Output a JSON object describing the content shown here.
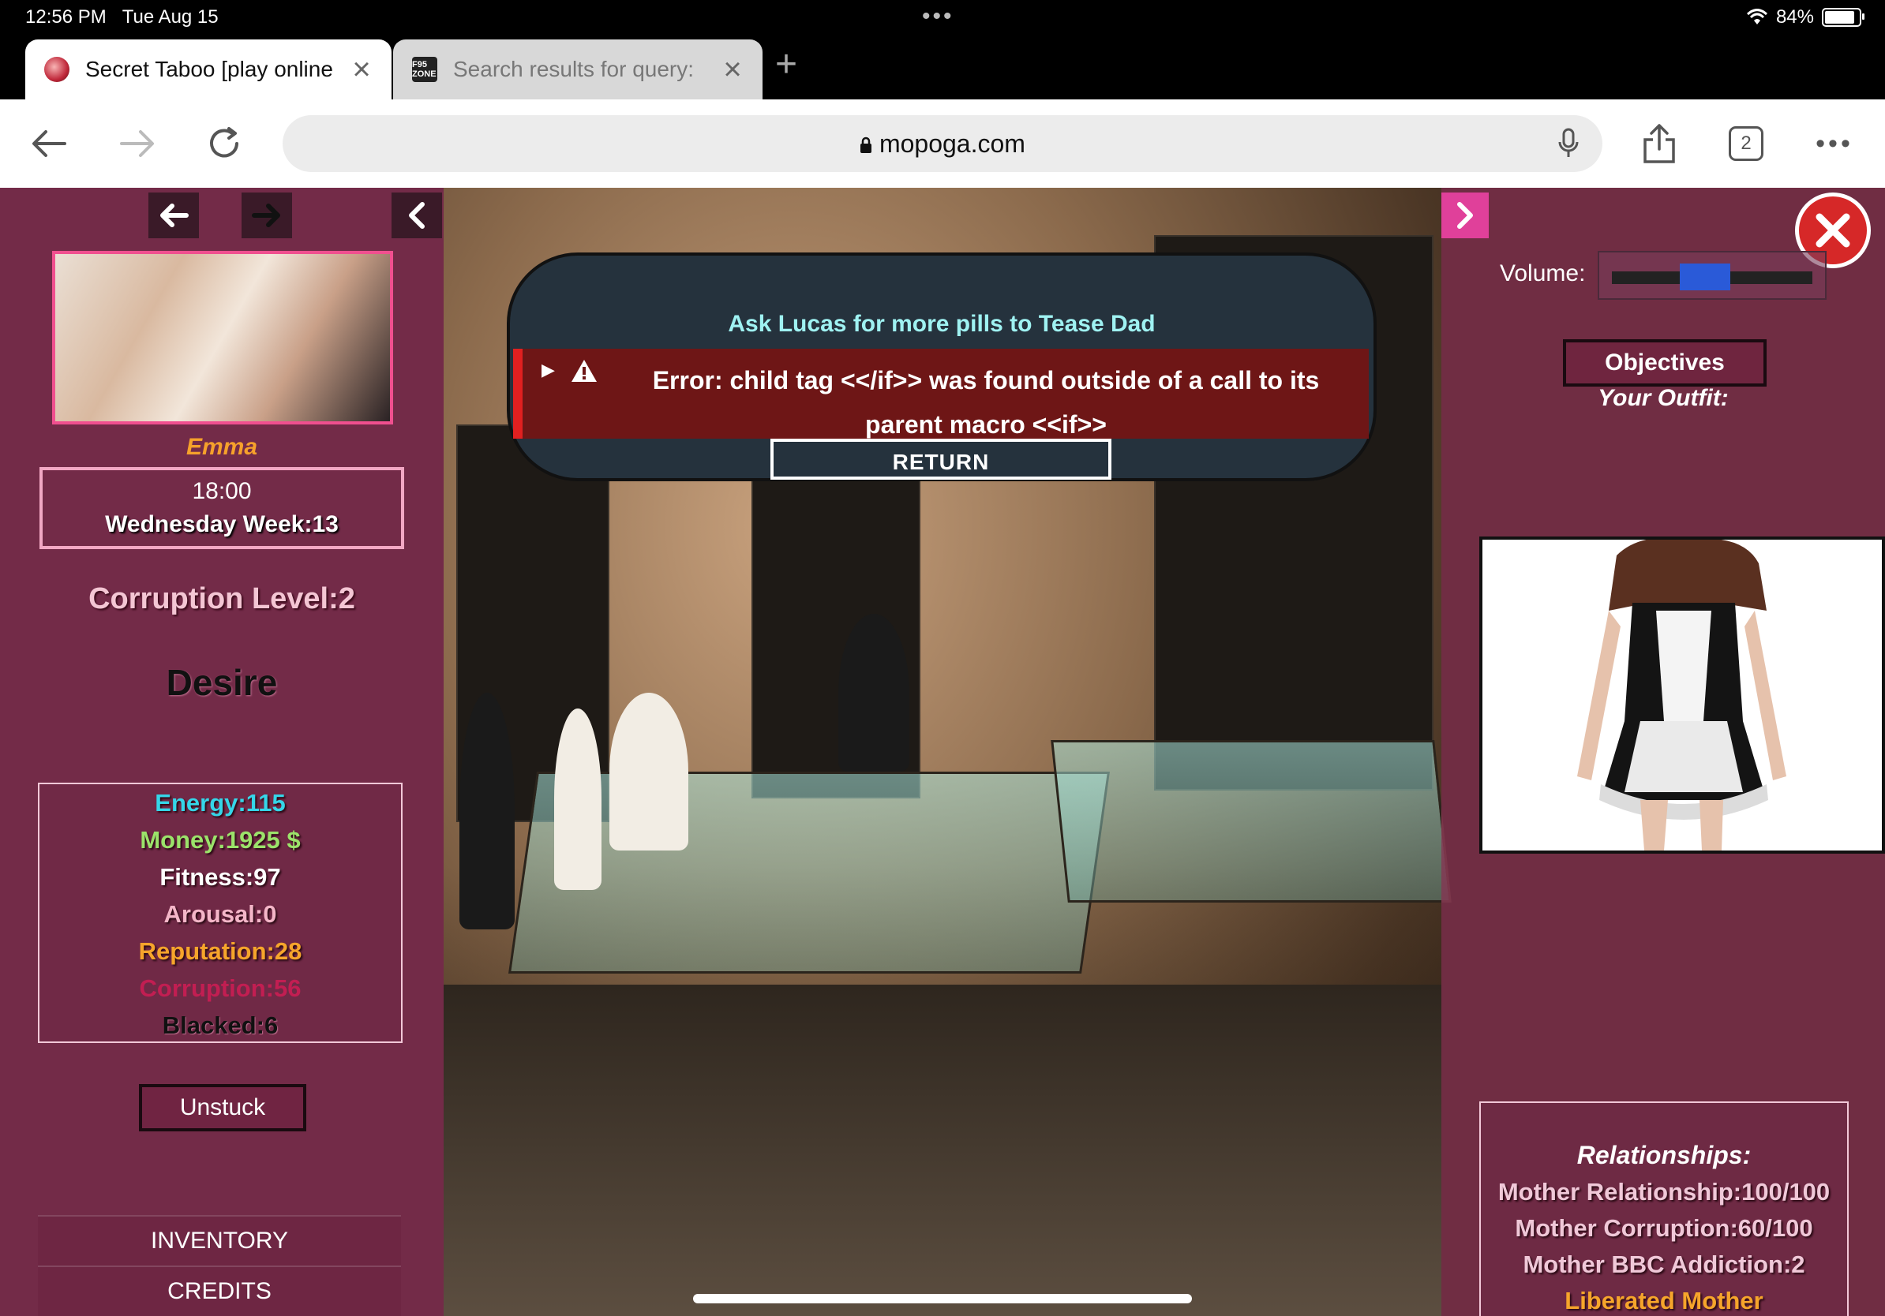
{
  "status": {
    "time": "12:56 PM",
    "date": "Tue Aug 15",
    "battery": "84%"
  },
  "tabs": [
    {
      "title": "Secret Taboo [play online",
      "active": true
    },
    {
      "title": "Search results for query:",
      "favicon_text": "F95 ZONE",
      "active": false
    }
  ],
  "toolbar": {
    "url": "mopoga.com",
    "tab_count": "2"
  },
  "left_panel": {
    "character_name": "Emma",
    "time": "18:00",
    "day": "Wednesday Week:13",
    "corruption_level": "Corruption Level:2",
    "mood": "Desire",
    "stats": [
      {
        "label": "Energy:115",
        "color": "#35d6e8"
      },
      {
        "label": "Money:1925 $",
        "color": "#9be36a"
      },
      {
        "label": "Fitness:97",
        "color": "#ffffff"
      },
      {
        "label": "Arousal:0",
        "color": "#f4b6c8"
      },
      {
        "label": "Reputation:28",
        "color": "#f6a52b"
      },
      {
        "label": "Corruption:56",
        "color": "#c21e52"
      },
      {
        "label": "Blacked:6",
        "color": "#111111"
      }
    ],
    "unstuck_label": "Unstuck",
    "menu": [
      "INVENTORY",
      "CREDITS"
    ]
  },
  "right_panel": {
    "volume_label": "Volume:",
    "volume_level": 0.45,
    "objectives_label": "Objectives",
    "outfit_label": "Your Outfit:",
    "relationships_title": "Relationships:",
    "relationships": [
      "Mother Relationship:100/100",
      "Mother Corruption:60/100",
      "Mother BBC Addiction:2",
      "Liberated Mother"
    ]
  },
  "dialog": {
    "title": "Ask Lucas for more pills to Tease Dad",
    "error": "Error: child tag <</if>> was found outside of a call to its parent macro <<if>>",
    "return_label": "RETURN"
  }
}
